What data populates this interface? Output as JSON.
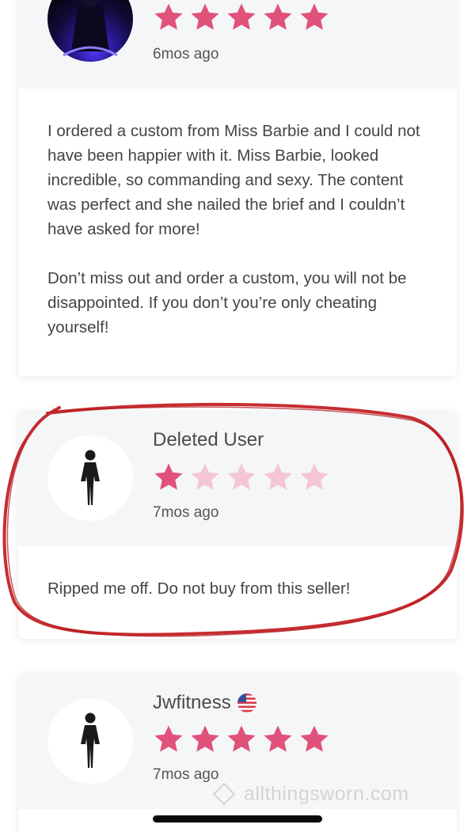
{
  "reviews": [
    {
      "rating": 5,
      "date": "6mos ago",
      "paragraphs": [
        "I ordered a custom from Miss Barbie and I could not have been happier with it. Miss Barbie, looked incredible, so commanding and sexy. The content was perfect and she nailed the brief and I couldn’t have asked for more!",
        "Don’t miss out and order a custom, you will not be disappointed. If you don’t you’re only cheating yourself!"
      ]
    },
    {
      "username": "Deleted User",
      "rating": 1,
      "date": "7mos ago",
      "text": "Ripped me off. Do not buy from this seller!"
    },
    {
      "username": "Jwfitness",
      "country_flag": "us-flag-icon",
      "rating": 5,
      "date": "7mos ago"
    }
  ],
  "watermark": "allthingsworn.com",
  "colors": {
    "star_full": "#e0527a",
    "star_empty": "#f4c6d4",
    "annotation_circle": "#c0161a"
  }
}
